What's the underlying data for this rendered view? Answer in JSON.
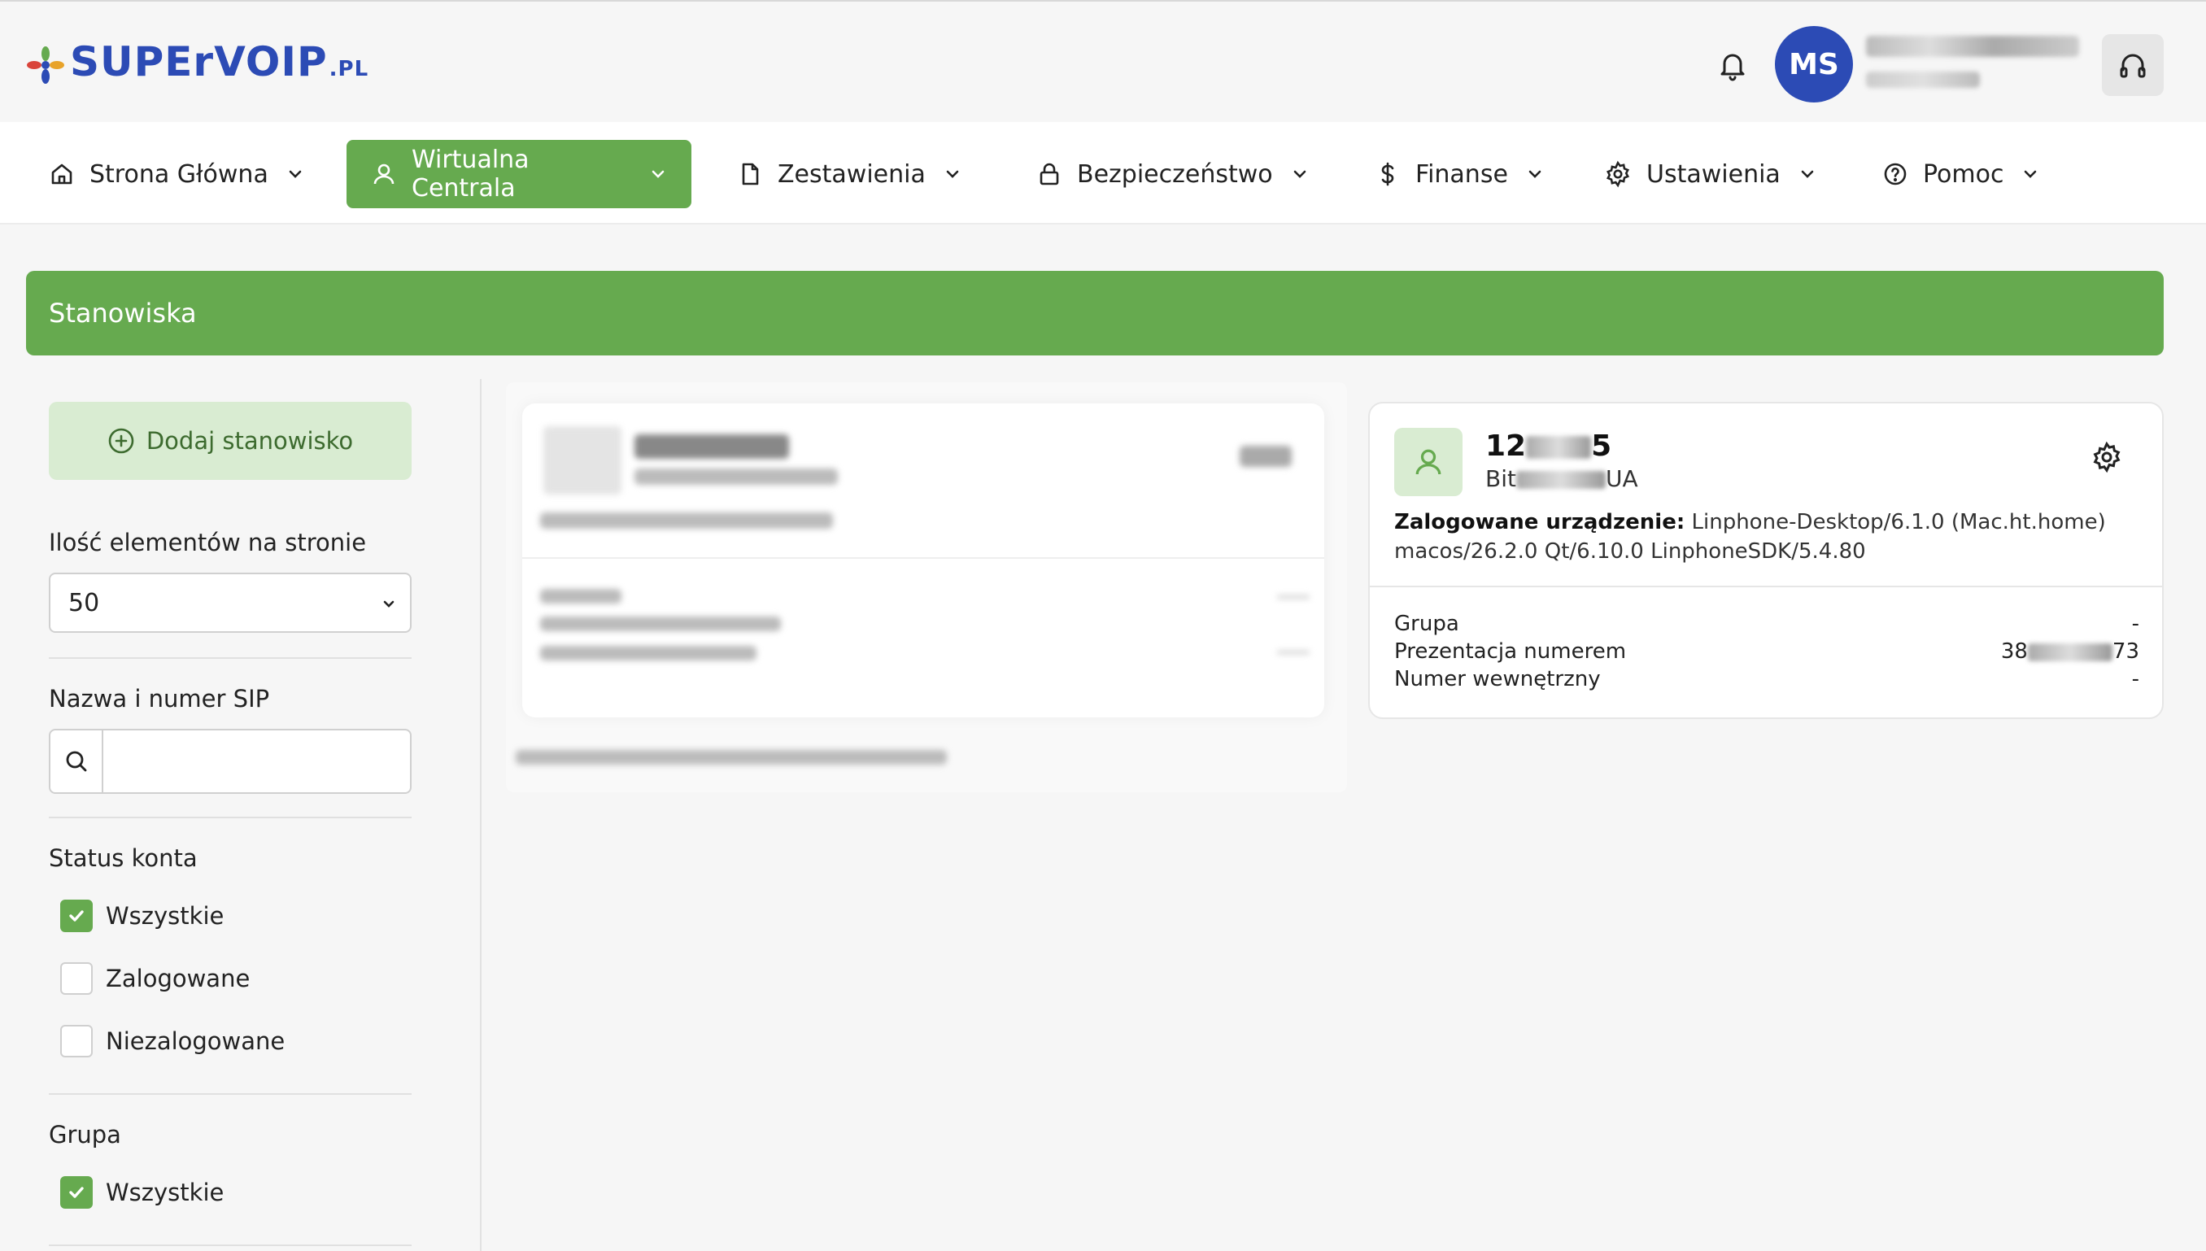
{
  "header": {
    "logo_text": "SUPErVOIP",
    "logo_suffix": ".PL",
    "avatar_initials": "MS"
  },
  "nav": {
    "items": [
      {
        "label": "Strona Główna",
        "icon": "home-icon"
      },
      {
        "label": "Wirtualna Centrala",
        "icon": "user-icon",
        "active": true
      },
      {
        "label": "Zestawienia",
        "icon": "document-icon"
      },
      {
        "label": "Bezpieczeństwo",
        "icon": "lock-icon"
      },
      {
        "label": "Finanse",
        "icon": "dollar-icon"
      },
      {
        "label": "Ustawienia",
        "icon": "gear-icon"
      },
      {
        "label": "Pomoc",
        "icon": "help-icon"
      }
    ]
  },
  "page": {
    "title": "Stanowiska"
  },
  "sidebar": {
    "add_button": "Dodaj stanowisko",
    "per_page_label": "Ilość elementów na stronie",
    "per_page_value": "50",
    "search_label": "Nazwa i numer SIP",
    "search_placeholder": "",
    "status_label": "Status konta",
    "status_options": [
      {
        "label": "Wszystkie",
        "checked": true
      },
      {
        "label": "Zalogowane",
        "checked": false
      },
      {
        "label": "Niezalogowane",
        "checked": false
      }
    ],
    "group_label": "Grupa",
    "group_options": [
      {
        "label": "Wszystkie",
        "checked": true
      }
    ]
  },
  "detail": {
    "number_prefix": "12",
    "number_suffix": "5",
    "subtitle_prefix": "Bit",
    "subtitle_suffix": "UA",
    "device_label": "Zalogowane urządzenie:",
    "device_value": "Linphone-Desktop/6.1.0 (Mac.ht.home) macos/26.2.0 Qt/6.10.0 LinphoneSDK/5.4.80",
    "rows": [
      {
        "label": "Grupa",
        "value": "-"
      },
      {
        "label": "Prezentacja numerem",
        "value_prefix": "38",
        "value_suffix": "73"
      },
      {
        "label": "Numer wewnętrzny",
        "value": "-"
      }
    ]
  },
  "colors": {
    "brand_green": "#66aa4f",
    "brand_blue": "#2c4bb5",
    "light_green": "#d9ecd2"
  }
}
